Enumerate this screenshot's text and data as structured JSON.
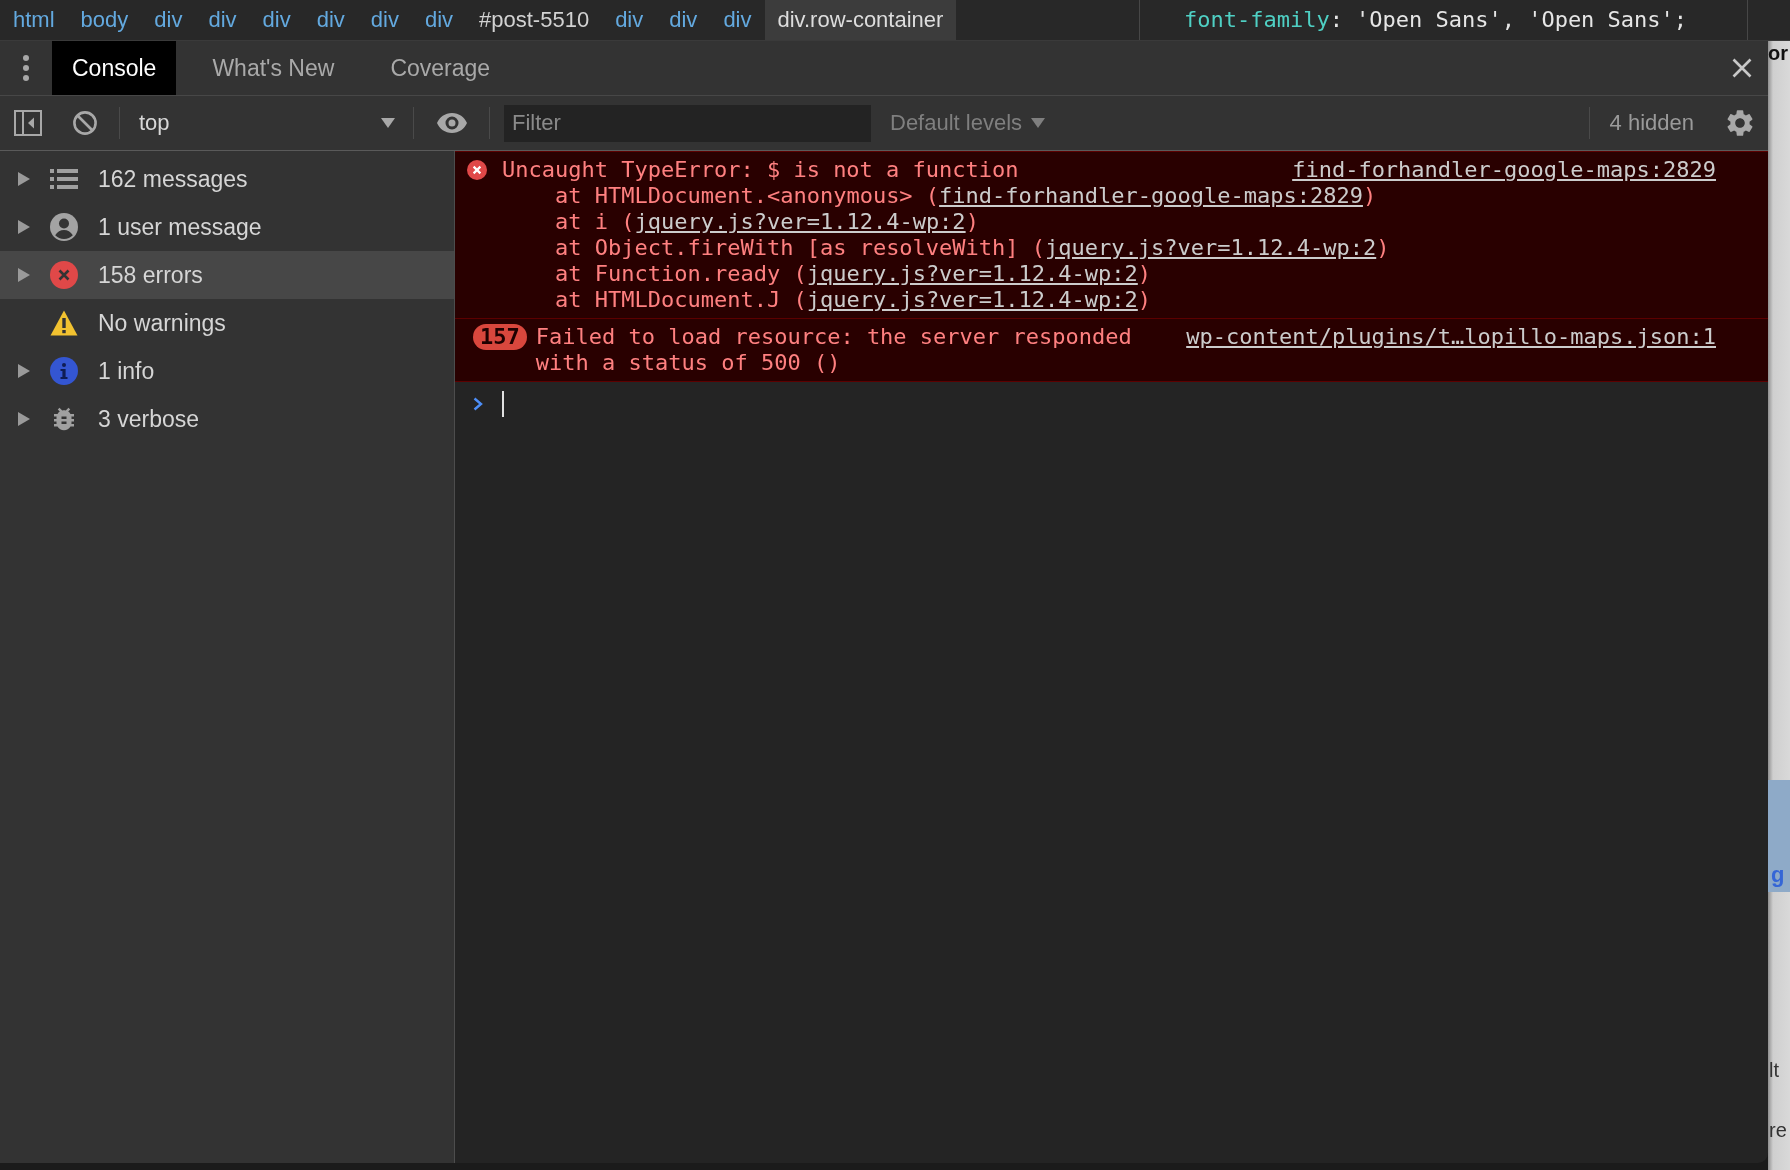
{
  "breadcrumbs": [
    {
      "label": "html",
      "kind": "tag",
      "selected": false
    },
    {
      "label": "body",
      "kind": "tag",
      "selected": false
    },
    {
      "label": "div",
      "kind": "tag",
      "selected": false
    },
    {
      "label": "div",
      "kind": "tag",
      "selected": false
    },
    {
      "label": "div",
      "kind": "tag",
      "selected": false
    },
    {
      "label": "div",
      "kind": "tag",
      "selected": false
    },
    {
      "label": "div",
      "kind": "tag",
      "selected": false
    },
    {
      "label": "div",
      "kind": "tag",
      "selected": false
    },
    {
      "label": "#post-5510",
      "kind": "id",
      "selected": false
    },
    {
      "label": "div",
      "kind": "tag",
      "selected": false
    },
    {
      "label": "div",
      "kind": "tag",
      "selected": false
    },
    {
      "label": "div",
      "kind": "tag",
      "selected": false
    },
    {
      "label": "div.row-container",
      "kind": "tag",
      "selected": true
    }
  ],
  "styles_pane": {
    "property": "font-family",
    "separator": ":",
    "value": "'Open Sans', 'Open Sans';"
  },
  "tabs": [
    {
      "label": "Console",
      "selected": true
    },
    {
      "label": "What's New",
      "selected": false
    },
    {
      "label": "Coverage",
      "selected": false
    }
  ],
  "toolbar": {
    "context": "top",
    "filter": {
      "placeholder": "Filter"
    },
    "levels": {
      "label": "Default levels",
      "disabled": true
    },
    "hidden": "4 hidden"
  },
  "sidebar": {
    "items": [
      {
        "kind": "all",
        "label": "162 messages",
        "expanded": false,
        "selected": false
      },
      {
        "kind": "user",
        "label": "1 user message",
        "expanded": false,
        "selected": false
      },
      {
        "kind": "error",
        "label": "158 errors",
        "expanded": false,
        "selected": true
      },
      {
        "kind": "warning",
        "label": "No warnings",
        "selected": false
      },
      {
        "kind": "info",
        "label": "1 info",
        "expanded": false,
        "selected": false
      },
      {
        "kind": "verbose",
        "label": "3 verbose",
        "expanded": false,
        "selected": false
      }
    ]
  },
  "console": {
    "messages": [
      {
        "kind": "error",
        "text": "Uncaught TypeError: $ is not a function",
        "source": "find-forhandler-google-maps:2829",
        "stack": [
          {
            "prefix": "at HTMLDocument.<anonymous> (",
            "link": "find-forhandler-google-maps:2829",
            "suffix": ")"
          },
          {
            "prefix": "at i (",
            "link": "jquery.js?ver=1.12.4-wp:2",
            "suffix": ")"
          },
          {
            "prefix": "at Object.fireWith [as resolveWith] (",
            "link": "jquery.js?ver=1.12.4-wp:2",
            "suffix": ")"
          },
          {
            "prefix": "at Function.ready (",
            "link": "jquery.js?ver=1.12.4-wp:2",
            "suffix": ")"
          },
          {
            "prefix": "at HTMLDocument.J (",
            "link": "jquery.js?ver=1.12.4-wp:2",
            "suffix": ")"
          }
        ]
      },
      {
        "kind": "error",
        "count": "157",
        "text": "Failed to load resource: the server responded with a status of 500 ()",
        "source": "wp-content/plugins/t…lopillo-maps.json:1"
      }
    ]
  },
  "page_fragments": [
    {
      "kind": "heading",
      "text": "or"
    },
    {
      "kind": "link",
      "text": "g"
    },
    {
      "kind": "body",
      "text": "lt"
    },
    {
      "kind": "body",
      "text": "re"
    }
  ]
}
